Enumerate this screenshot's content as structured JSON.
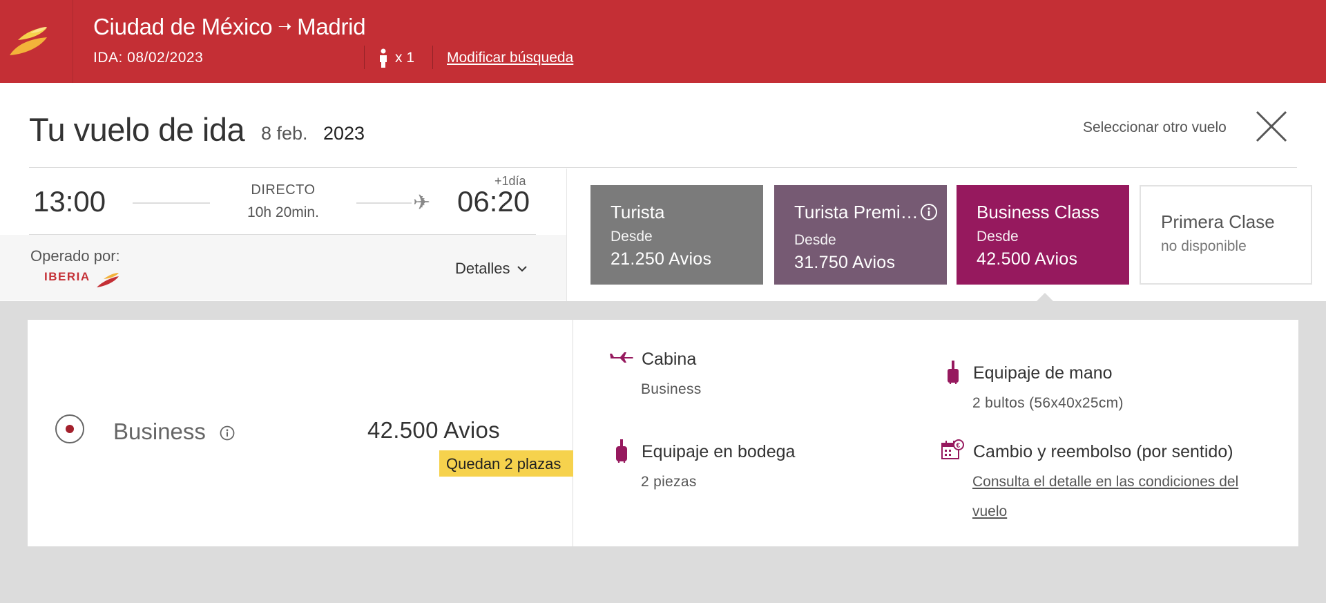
{
  "header": {
    "origin": "Ciudad de México",
    "arrow": "➝",
    "destination": "Madrid",
    "ida": "IDA: 08/02/2023",
    "passengers": "x 1",
    "modify_label": "Modificar búsqueda"
  },
  "page": {
    "title": "Tu vuelo de ida",
    "date_day": "8 feb.",
    "date_year": "2023",
    "select_other": "Seleccionar otro vuelo"
  },
  "flight": {
    "departure_time": "13:00",
    "type": "DIRECTO",
    "duration": "10h 20min.",
    "arrival_time": "06:20",
    "plus_day": "+1día",
    "operated_by": "Operado por:",
    "operator": "IBERIA",
    "details_label": "Detalles"
  },
  "fares": [
    {
      "name": "Turista",
      "from": "Desde",
      "price": "21.250 Avios",
      "color": "#7b7b7b"
    },
    {
      "name": "Turista Premium",
      "from": "Desde",
      "price": "31.750 Avios",
      "color": "#765a73"
    },
    {
      "name": "Business Class",
      "from": "Desde",
      "price": "42.500 Avios",
      "color": "#96195e"
    },
    {
      "name": "Primera Clase",
      "unavailable": "no disponible",
      "color": "#ffffff"
    }
  ],
  "selected_fare": {
    "name": "Business",
    "price": "42.500 Avios",
    "seats_left": "Quedan 2 plazas"
  },
  "features": {
    "cabin_title": "Cabina",
    "cabin_value": "Business",
    "carry_on_title": "Equipaje de mano",
    "carry_on_value": "2 bultos (56x40x25cm)",
    "checked_title": "Equipaje en bodega",
    "checked_value": "2 piezas",
    "change_title": "Cambio y reembolso (por sentido)",
    "change_link": "Consulta el detalle en las condiciones del vuelo"
  },
  "colors": {
    "brand_red": "#c42f35",
    "business_purple": "#96195e",
    "seats_badge": "#f6d24d"
  }
}
